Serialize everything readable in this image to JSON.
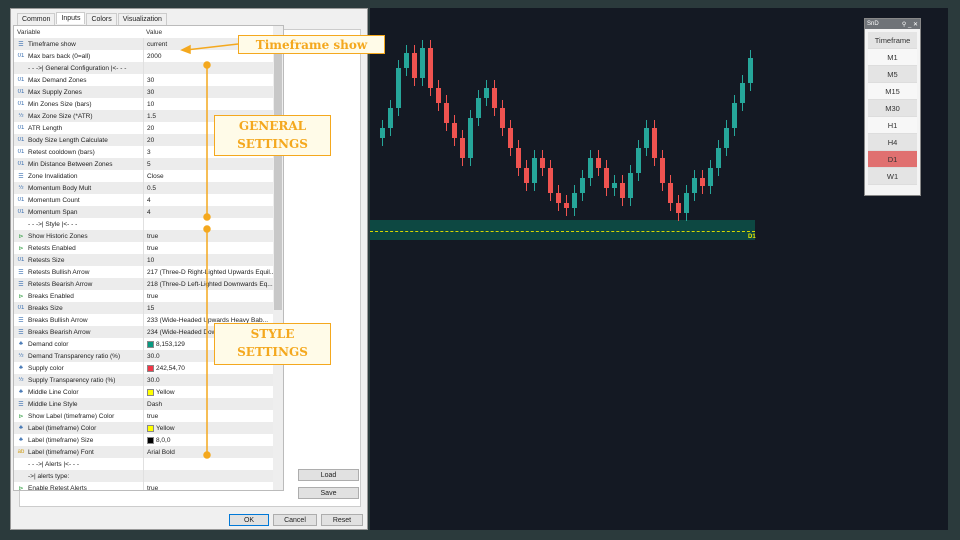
{
  "tabs": [
    "Common",
    "Inputs",
    "Colors",
    "Visualization"
  ],
  "grid_header": {
    "variable": "Variable",
    "value": "Value"
  },
  "rows": [
    {
      "icon": "enum",
      "var": "Timeframe show",
      "val": "current"
    },
    {
      "icon": "int",
      "var": "Max bars back (0=all)",
      "val": "2000"
    },
    {
      "icon": "",
      "var": "- - ->| General Configuration |<- - -",
      "val": ""
    },
    {
      "icon": "int",
      "var": "Max Demand Zones",
      "val": "30"
    },
    {
      "icon": "int",
      "var": "Max Supply Zones",
      "val": "30"
    },
    {
      "icon": "int",
      "var": "Min Zones Size (bars)",
      "val": "10"
    },
    {
      "icon": "double",
      "var": "Max Zone Size (*ATR)",
      "val": "1.5"
    },
    {
      "icon": "int",
      "var": "ATR Length",
      "val": "20"
    },
    {
      "icon": "int",
      "var": "Body Size Length Calculate",
      "val": "20"
    },
    {
      "icon": "int",
      "var": "Retest cooldown (bars)",
      "val": "3"
    },
    {
      "icon": "int",
      "var": "Min Distance Between Zones",
      "val": "5"
    },
    {
      "icon": "enum",
      "var": "Zone Invalidation",
      "val": "Close"
    },
    {
      "icon": "double",
      "var": "Momentum Body Mult",
      "val": "0.5"
    },
    {
      "icon": "int",
      "var": "Momentum Count",
      "val": "4"
    },
    {
      "icon": "int",
      "var": "Momentum Span",
      "val": "4"
    },
    {
      "icon": "",
      "var": "- - ->| Style |<- - -",
      "val": ""
    },
    {
      "icon": "bool",
      "var": "Show Historic Zones",
      "val": "true"
    },
    {
      "icon": "bool",
      "var": "Retests Enabled",
      "val": "true"
    },
    {
      "icon": "int",
      "var": "Retests Size",
      "val": "10"
    },
    {
      "icon": "enum",
      "var": "Retests Bullish Arrow",
      "val": "217 (Three-D Right-Lighted Upwards Equil..."
    },
    {
      "icon": "enum",
      "var": "Retests Bearish Arrow",
      "val": "218 (Three-D Left-Lighted Downwards Eq..."
    },
    {
      "icon": "bool",
      "var": "Breaks Enabled",
      "val": "true"
    },
    {
      "icon": "int",
      "var": "Breaks Size",
      "val": "15"
    },
    {
      "icon": "enum",
      "var": "Breaks Bullish Arrow",
      "val": "233 (Wide-Headed Upwards Heavy Bab..."
    },
    {
      "icon": "enum",
      "var": "Breaks Bearish Arrow",
      "val": "234 (Wide-Headed Downwards Heavy..."
    },
    {
      "icon": "color",
      "var": "Demand color",
      "val": "8,153,129",
      "swatch": "#089981"
    },
    {
      "icon": "double",
      "var": "Demand Transparency ratio (%)",
      "val": "30.0"
    },
    {
      "icon": "color",
      "var": "Supply color",
      "val": "242,54,70",
      "swatch": "#f23646"
    },
    {
      "icon": "double",
      "var": "Supply Transparency ratio (%)",
      "val": "30.0"
    },
    {
      "icon": "color",
      "var": "Middle Line Color",
      "val": "Yellow",
      "swatch": "#ffff00"
    },
    {
      "icon": "enum",
      "var": "Middle Line Style",
      "val": "Dash"
    },
    {
      "icon": "bool",
      "var": "Show Label (timeframe) Color",
      "val": "true"
    },
    {
      "icon": "color",
      "var": "Label (timeframe) Color",
      "val": "Yellow",
      "swatch": "#ffff00"
    },
    {
      "icon": "color",
      "var": "Label (timeframe) Size",
      "val": "8,0,0",
      "swatch": "#000000"
    },
    {
      "icon": "string",
      "var": "Label (timeframe) Font",
      "val": "Arial Bold"
    },
    {
      "icon": "",
      "var": "- - ->| Alerts |<- - -",
      "val": ""
    },
    {
      "icon": "",
      "var": "->| alerts type:",
      "val": ""
    },
    {
      "icon": "bool",
      "var": "Enable Retest Alerts",
      "val": "true"
    }
  ],
  "buttons": {
    "load": "Load",
    "save": "Save",
    "ok": "OK",
    "cancel": "Cancel",
    "reset": "Reset"
  },
  "annotations": {
    "timeframe": "Timeframe show",
    "general1": "GENERAL",
    "general2": "SETTINGS",
    "style1": "STYLE",
    "style2": "SETTINGS"
  },
  "chart": {
    "zone_label": "D1",
    "bull_color": "#26a69a",
    "bear_color": "#ef5350"
  },
  "tf_panel": {
    "title": "SnD",
    "header": "Timeframe",
    "items": [
      "M1",
      "M5",
      "M15",
      "M30",
      "H1",
      "H4",
      "D1",
      "W1"
    ],
    "active": "D1"
  }
}
